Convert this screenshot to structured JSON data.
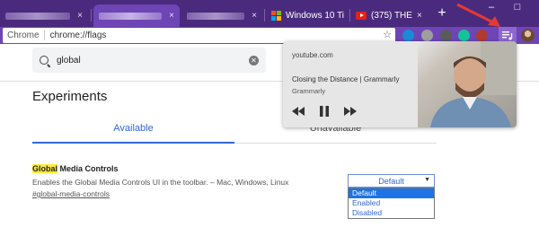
{
  "browser": {
    "tabs": [
      {
        "label": "",
        "blurred": true
      },
      {
        "label": "",
        "blurred": true,
        "active": true
      },
      {
        "label": "",
        "blurred": true
      },
      {
        "label": "Windows 10 Ti",
        "favicon": "windows-icon"
      },
      {
        "label": "(375) THE",
        "favicon": "youtube-icon"
      }
    ],
    "tab_close_glyph": "×",
    "new_tab_glyph": "+",
    "window_controls": [
      "–",
      "□"
    ],
    "omnibox": {
      "scheme_label": "Chrome",
      "url": "chrome://flags",
      "star_glyph": "☆"
    },
    "extensions": [
      {
        "name": "puzzle-extension-icon",
        "color": "#1a8ad6"
      },
      {
        "name": "grey-extension-icon",
        "color": "#9e9e9e"
      },
      {
        "name": "dark-extension-icon",
        "color": "#5b5b5b"
      },
      {
        "name": "grammarly-icon",
        "color": "#15c39a"
      },
      {
        "name": "photo-extension-icon",
        "color": "#b03a2e"
      }
    ]
  },
  "page": {
    "search_query": "global",
    "clear_glyph": "✕",
    "title": "Experiments",
    "tabs": {
      "available": "Available",
      "unavailable": "Unavailable"
    },
    "experiment": {
      "name_highlight": "Global",
      "name_rest": " Media Controls",
      "description": "Enables the Global Media Controls UI in the toolbar. – Mac, Windows, Linux",
      "link": "#global-media-controls",
      "select_value": "Default",
      "caret": "▼",
      "options": [
        "Default",
        "Enabled",
        "Disabled"
      ],
      "selected_option": 0
    }
  },
  "media_popup": {
    "origin": "youtube.com",
    "title": "Closing the Distance | Grammarly",
    "artist": "Grammarly"
  },
  "colors": {
    "tabstrip": "#4a2a7d",
    "toolbar": "#6e45b5",
    "link_blue": "#3367d6",
    "highlight": "#ffeb3b",
    "annotation_arrow": "#e53935"
  }
}
